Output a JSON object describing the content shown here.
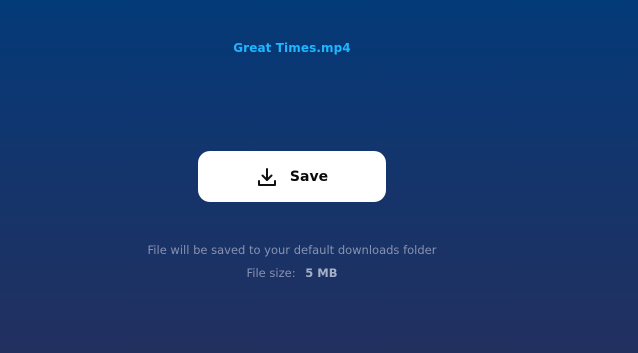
{
  "file": {
    "name": "Great Times.mp4",
    "name_color": "#1fb6ff"
  },
  "save_button": {
    "label": "Save",
    "icon": "download-icon",
    "background": "#ffffff"
  },
  "info": {
    "hint": "File will be saved to your default downloads folder",
    "size_label": "File size:",
    "size_value": "5 MB"
  },
  "colors": {
    "background_top": "#033a78",
    "background_bottom": "#22305f",
    "muted_text": "#8892b0"
  }
}
